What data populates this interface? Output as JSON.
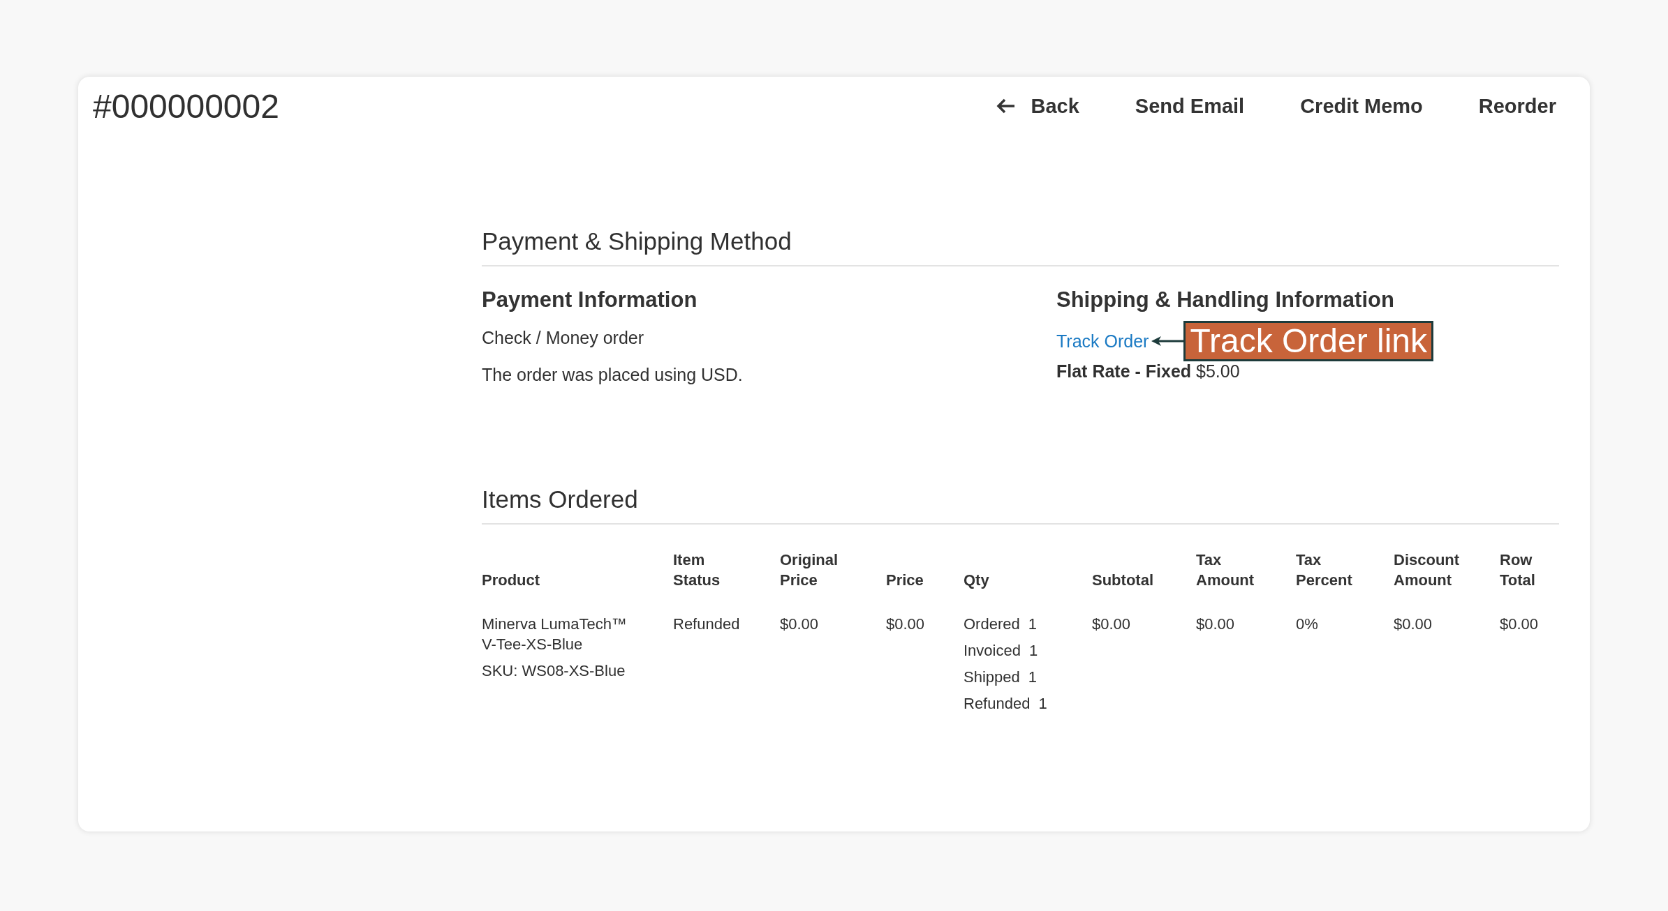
{
  "header": {
    "title": "#000000002",
    "actions": [
      {
        "label": "Back",
        "kind": "back"
      },
      {
        "label": "Send Email",
        "kind": "plain"
      },
      {
        "label": "Credit Memo",
        "kind": "plain"
      },
      {
        "label": "Reorder",
        "kind": "plain"
      }
    ]
  },
  "payment_shipping": {
    "title": "Payment & Shipping Method",
    "payment": {
      "title": "Payment Information",
      "lines": [
        "Check / Money order",
        "The order was placed using USD."
      ]
    },
    "shipping": {
      "title": "Shipping & Handling Information",
      "track_link": "Track Order",
      "method_label": "Flat Rate - Fixed",
      "method_price": "$5.00"
    }
  },
  "annotation": {
    "label": "Track Order link"
  },
  "items": {
    "title": "Items Ordered",
    "columns": [
      "Product",
      "Item Status",
      "Original Price",
      "Price",
      "Qty",
      "Subtotal",
      "Tax Amount",
      "Tax Percent",
      "Discount Amount",
      "Row Total"
    ],
    "rows": [
      {
        "product_name": "Minerva LumaTech™ V-Tee-XS-Blue",
        "sku": "SKU: WS08-XS-Blue",
        "status": "Refunded",
        "original_price": "$0.00",
        "price": "$0.00",
        "qty": [
          {
            "label": "Ordered",
            "value": "1"
          },
          {
            "label": "Invoiced",
            "value": "1"
          },
          {
            "label": "Shipped",
            "value": "1"
          },
          {
            "label": "Refunded",
            "value": "1"
          }
        ],
        "subtotal": "$0.00",
        "tax_amount": "$0.00",
        "tax_percent": "0%",
        "discount_amount": "$0.00",
        "row_total": "$0.00"
      }
    ]
  }
}
